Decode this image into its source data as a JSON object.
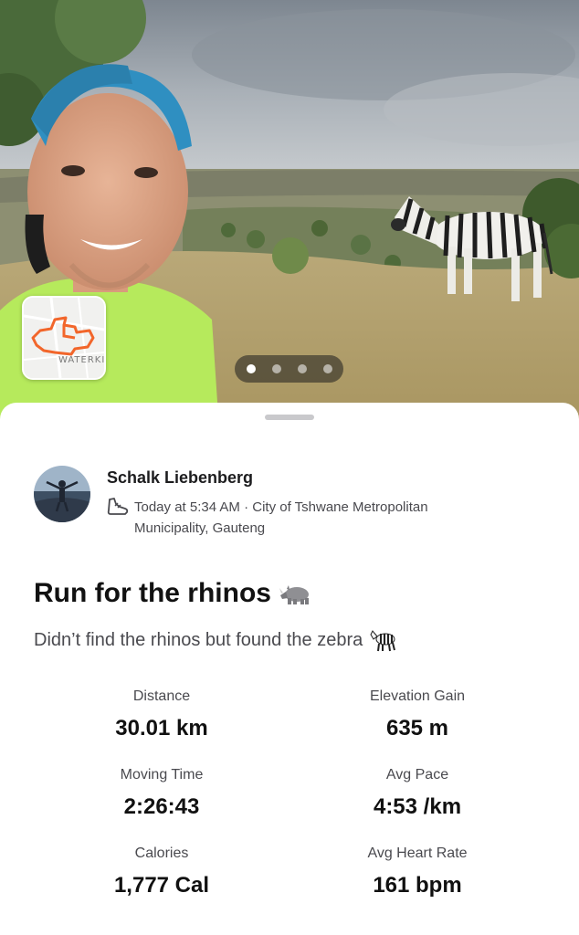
{
  "map_thumbnail": {
    "label": "WATERKI"
  },
  "pager": {
    "count": 4,
    "active_index": 0
  },
  "athlete": {
    "name": "Schalk Liebenberg",
    "meta": "Today at 5:34 AM · City of Tshwane Metropolitan Municipality, Gauteng"
  },
  "activity": {
    "title": "Run for the rhinos",
    "description": "Didn’t find the rhinos but found the zebra"
  },
  "stats": {
    "distance": {
      "label": "Distance",
      "value": "30.01 km"
    },
    "elevation_gain": {
      "label": "Elevation Gain",
      "value": "635 m"
    },
    "moving_time": {
      "label": "Moving Time",
      "value": "2:26:43"
    },
    "avg_pace": {
      "label": "Avg Pace",
      "value": "4:53 /km"
    },
    "calories": {
      "label": "Calories",
      "value": "1,777 Cal"
    },
    "avg_heart_rate": {
      "label": "Avg Heart Rate",
      "value": "161 bpm"
    }
  },
  "colors": {
    "route": "#f2662b",
    "accent": "#fc4c02",
    "shirt": "#b6ea5c",
    "cap": "#2f8fc1"
  }
}
